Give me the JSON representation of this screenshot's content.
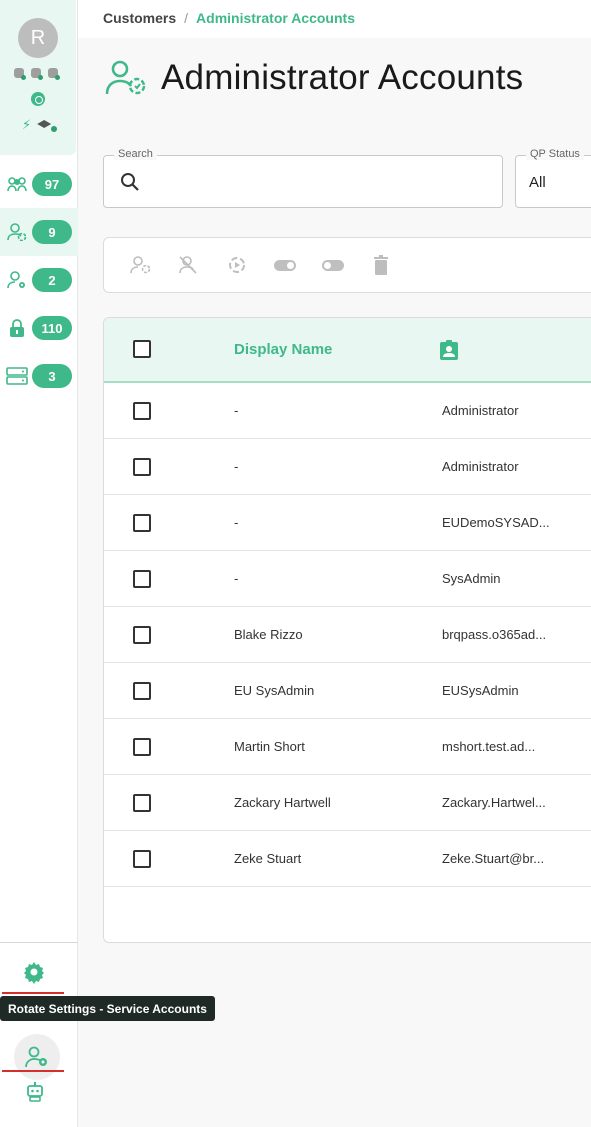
{
  "breadcrumb": {
    "parent": "Customers",
    "separator": "/",
    "current": "Administrator Accounts"
  },
  "page": {
    "title": "Administrator Accounts"
  },
  "user": {
    "initial": "R"
  },
  "sidebar": {
    "items": [
      {
        "icon": "users-group-icon",
        "count": "97"
      },
      {
        "icon": "admin-user-icon",
        "count": "9"
      },
      {
        "icon": "service-account-icon",
        "count": "2"
      },
      {
        "icon": "lock-icon",
        "count": "110"
      },
      {
        "icon": "server-icon",
        "count": "3"
      }
    ],
    "tooltip": "Rotate Settings - Service Accounts"
  },
  "filters": {
    "search_label": "Search",
    "qp_status_label": "QP Status",
    "qp_status_value": "All"
  },
  "table": {
    "columns": {
      "display_name": "Display Name"
    },
    "rows": [
      {
        "name": "-",
        "upn": "Administrator"
      },
      {
        "name": "-",
        "upn": "Administrator"
      },
      {
        "name": "-",
        "upn": "EUDemoSYSAD..."
      },
      {
        "name": "-",
        "upn": "SysAdmin"
      },
      {
        "name": "Blake Rizzo",
        "upn": "brqpass.o365ad..."
      },
      {
        "name": "EU SysAdmin",
        "upn": "EUSysAdmin"
      },
      {
        "name": "Martin Short",
        "upn": "mshort.test.ad..."
      },
      {
        "name": "Zackary Hartwell",
        "upn": "Zackary.Hartwel..."
      },
      {
        "name": "Zeke Stuart",
        "upn": "Zeke.Stuart@br..."
      }
    ]
  },
  "colors": {
    "accent": "#3fb88a",
    "accent_light": "#e8f7f1",
    "tooltip_bg": "#1f2a26",
    "highlight_red": "#d32f2f"
  }
}
